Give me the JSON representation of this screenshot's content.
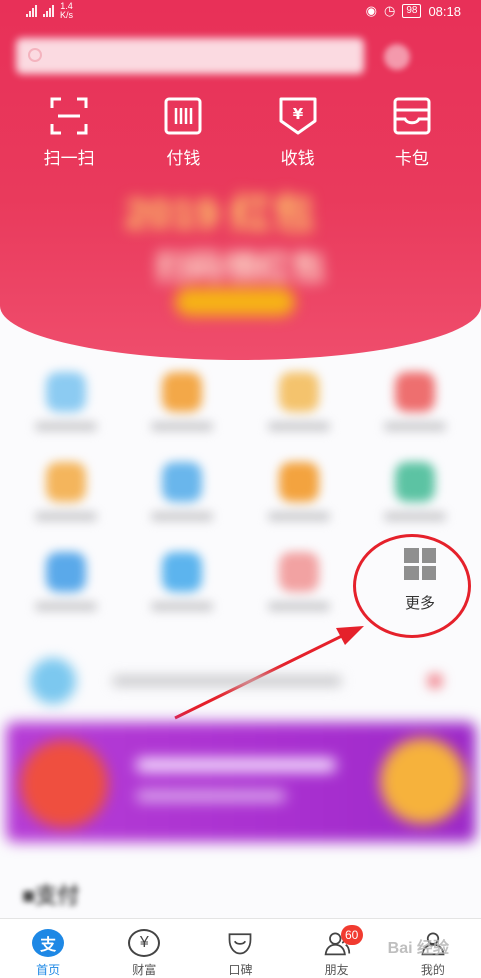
{
  "statusbar": {
    "network_speed": "1.4\nK/s",
    "battery": "98",
    "time": "08:18"
  },
  "quick_actions": [
    {
      "label": "扫一扫",
      "icon": "scan-icon"
    },
    {
      "label": "付钱",
      "icon": "pay-code-icon"
    },
    {
      "label": "收钱",
      "icon": "receive-money-icon"
    },
    {
      "label": "卡包",
      "icon": "card-wallet-icon"
    }
  ],
  "more_tile": {
    "label": "更多",
    "icon": "more-grid-icon"
  },
  "tabs": [
    {
      "label": "首页",
      "icon": "alipay-home-icon",
      "active": true
    },
    {
      "label": "财富",
      "icon": "wealth-yen-icon"
    },
    {
      "label": "口碑",
      "icon": "koubei-icon"
    },
    {
      "label": "朋友",
      "icon": "friends-icon",
      "badge": "60"
    },
    {
      "label": "我的",
      "icon": "profile-icon"
    }
  ],
  "tab_home_glyph": "支",
  "tab_wealth_glyph": "¥",
  "colors": {
    "header": "#e83058",
    "active_tab": "#1e88e5",
    "badge": "#f13b30",
    "annotation": "#e5212b"
  }
}
